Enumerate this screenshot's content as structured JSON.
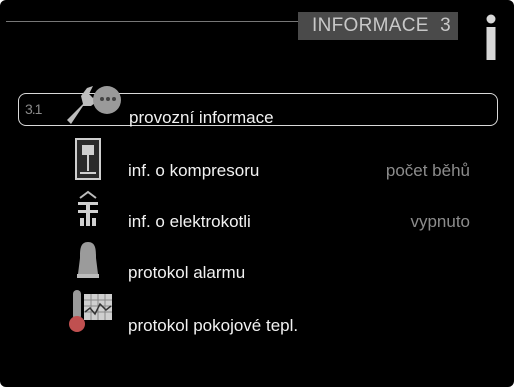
{
  "header": {
    "title": "INFORMACE",
    "menu_number": "3",
    "info_icon": "info-icon"
  },
  "menu": {
    "items": [
      {
        "index": "3.1",
        "label": "provozní informace",
        "value": "",
        "icon": "wrench-icon",
        "selected": true
      },
      {
        "label": "inf. o kompresoru",
        "value": "počet běhů",
        "icon": "compressor-icon"
      },
      {
        "label": "inf. o elektrokotli",
        "value": "vypnuto",
        "icon": "electric-heater-icon"
      },
      {
        "label": "protokol alarmu",
        "value": "",
        "icon": "bell-icon"
      },
      {
        "label": "protokol pokojové tepl.",
        "value": "",
        "icon": "thermometer-log-icon"
      }
    ]
  },
  "colors": {
    "background": "#000000",
    "title_bar": "#4a4a4a",
    "text": "#f2f2f2",
    "value_text": "#8c8c8c"
  }
}
